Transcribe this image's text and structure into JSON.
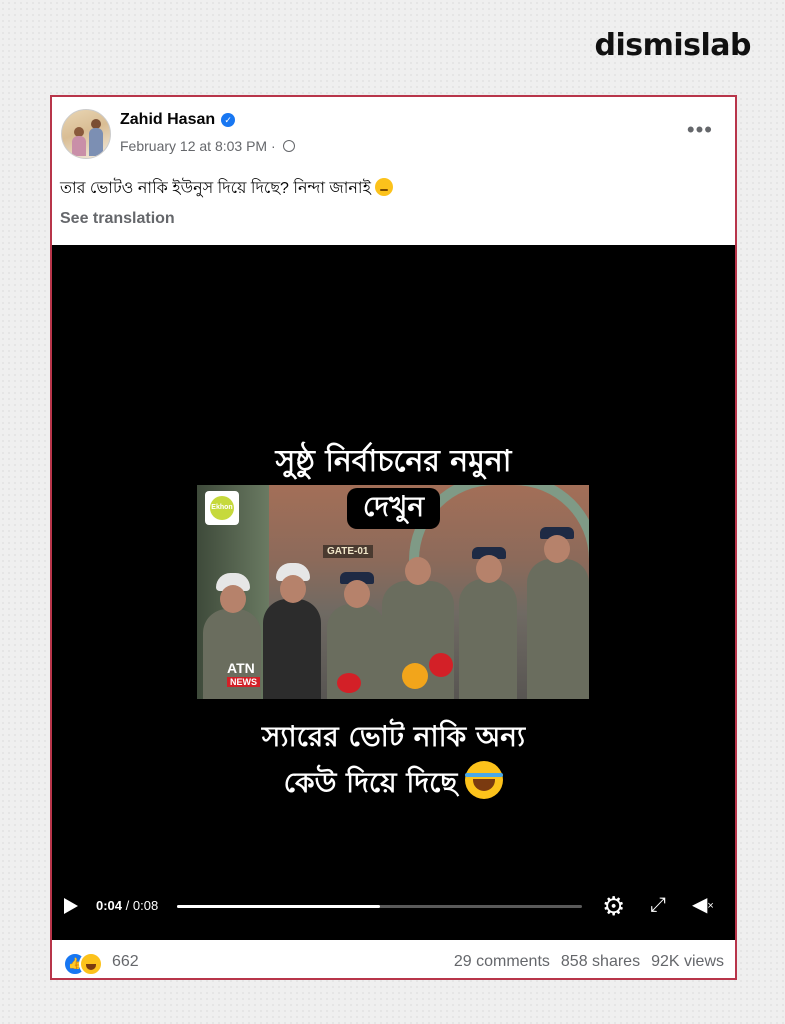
{
  "brand": "dismislab",
  "post": {
    "author": "Zahid Hasan",
    "verified_icon": "verified-badge-icon",
    "timestamp": "February 12 at 8:03 PM",
    "separator": " · ",
    "privacy_icon": "globe-icon",
    "more_icon": "more-options-icon",
    "more_label": "•••",
    "caption": "তার ভোটও নাকি ইউনুস দিয়ে দিছে? নিন্দা জানাই",
    "see_translation": "See translation"
  },
  "video": {
    "title_line1": "সুষ্ঠু নির্বাচনের নমুনা",
    "title_line2": "দেখুন",
    "frame_gate_text": "GATE-01",
    "frame_logo_text": "Ekhon",
    "frame_channel": "ATN",
    "frame_channel_sub": "NEWS",
    "subtitle_line1": "স্যারের ভোট নাকি অন্য",
    "subtitle_line2": "কেউ দিয়ে দিছে",
    "controls": {
      "current_time": "0:04",
      "total_time": " / 0:08",
      "progress": 0.5,
      "settings_icon": "gear-icon",
      "fullscreen_icon": "expand-icon",
      "volume_icon": "mute-icon"
    }
  },
  "footer": {
    "reactions": [
      "like",
      "haha"
    ],
    "reaction_count": "662",
    "comments": "29 comments",
    "shares": "858 shares",
    "views": "92K views"
  },
  "colors": {
    "card_border": "#b8354a",
    "facebook_blue": "#1877f2",
    "muted_text": "#65676b"
  }
}
